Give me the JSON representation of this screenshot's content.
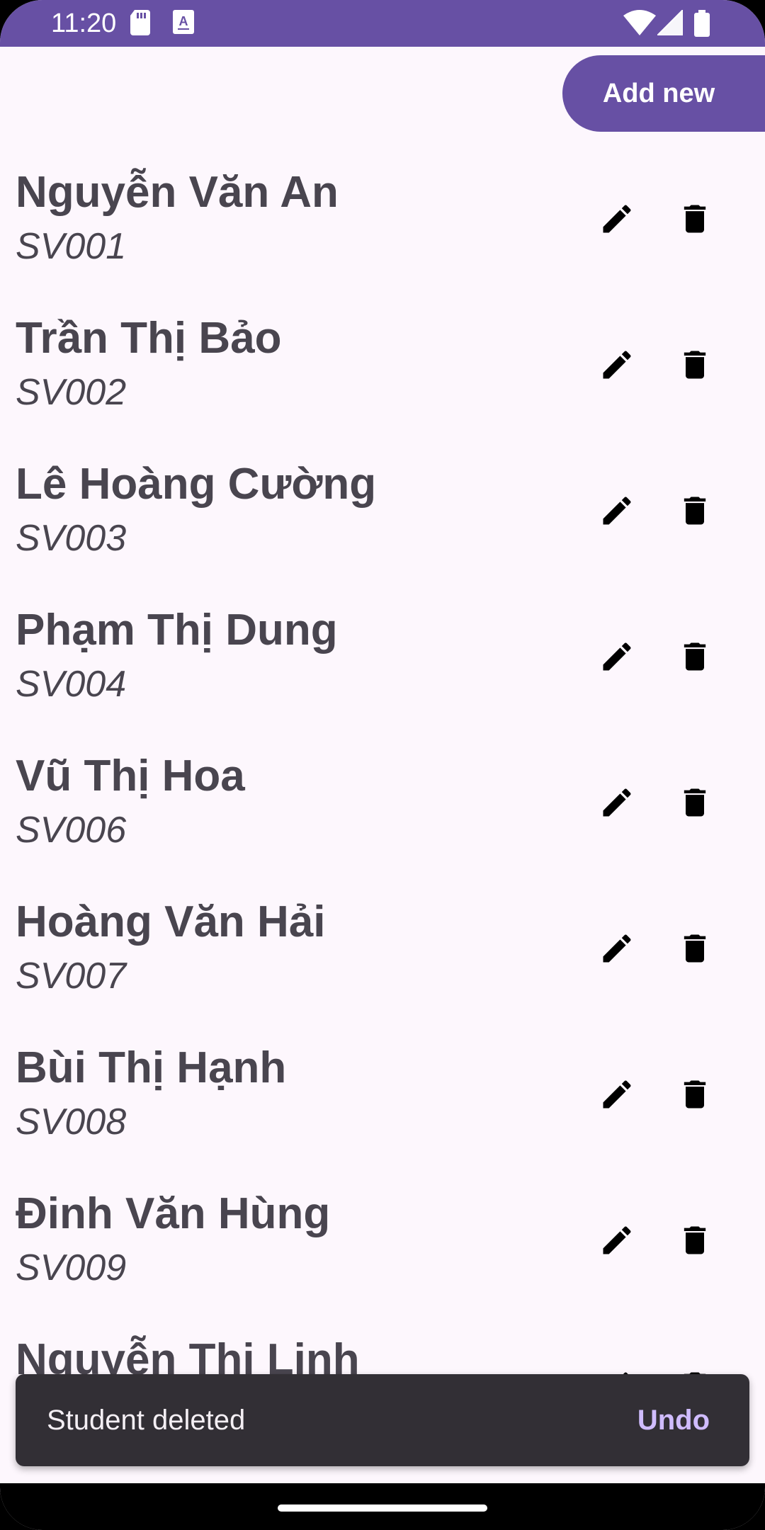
{
  "status_bar": {
    "time": "11:20",
    "left_icons": [
      "sd-card-icon",
      "text-a-icon"
    ],
    "right_icons": [
      "wifi-icon",
      "signal-icon",
      "battery-icon"
    ],
    "color": "#6750a4"
  },
  "toolbar": {
    "add_label": "Add new"
  },
  "students": [
    {
      "name": "Nguyễn Văn An",
      "code": "SV001"
    },
    {
      "name": "Trần Thị Bảo",
      "code": "SV002"
    },
    {
      "name": "Lê Hoàng Cường",
      "code": "SV003"
    },
    {
      "name": "Phạm Thị Dung",
      "code": "SV004"
    },
    {
      "name": "Vũ Thị Hoa",
      "code": "SV006"
    },
    {
      "name": "Hoàng Văn Hải",
      "code": "SV007"
    },
    {
      "name": "Bùi Thị Hạnh",
      "code": "SV008"
    },
    {
      "name": "Đinh Văn Hùng",
      "code": "SV009"
    },
    {
      "name": "Nguyễn Thị Linh",
      "code": ""
    }
  ],
  "row_icons": {
    "edit": "pencil-icon",
    "delete": "trash-icon"
  },
  "snackbar": {
    "message": "Student deleted",
    "action": "Undo"
  },
  "colors": {
    "accent": "#6750a4",
    "background": "#fdf7fd",
    "text": "#49454f",
    "snackbar_bg": "#322f35",
    "snackbar_action": "#d0bcff"
  }
}
